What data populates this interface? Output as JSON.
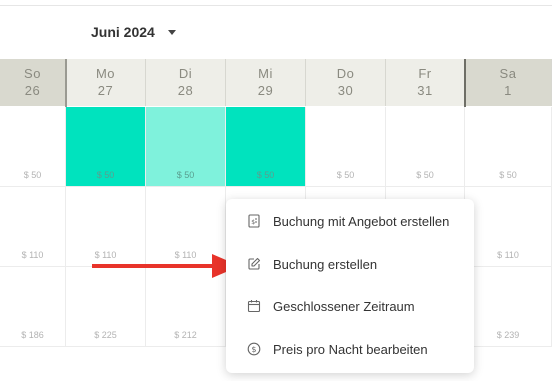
{
  "header": {
    "month": "Juni 2024",
    "month_dropdown_icon": "caret-down-icon"
  },
  "days": [
    {
      "name": "So",
      "date": "26",
      "type": "weekend"
    },
    {
      "name": "Mo",
      "date": "27",
      "type": "week"
    },
    {
      "name": "Di",
      "date": "28",
      "type": "week"
    },
    {
      "name": "Mi",
      "date": "29",
      "type": "week"
    },
    {
      "name": "Do",
      "date": "30",
      "type": "week"
    },
    {
      "name": "Fr",
      "date": "31",
      "type": "week"
    },
    {
      "name": "Sa",
      "date": "1",
      "type": "weekend"
    }
  ],
  "rows": [
    {
      "prices": [
        "$ 50",
        "$ 50",
        "$ 50",
        "$ 50",
        "$ 50",
        "$ 50",
        "$ 50"
      ],
      "states": [
        "free",
        "booked",
        "booked-light",
        "booked",
        "free",
        "free",
        "free"
      ]
    },
    {
      "prices": [
        "$ 110",
        "$ 110",
        "$ 110",
        "",
        "",
        "",
        "$ 110"
      ],
      "states": [
        "free",
        "free",
        "free",
        "free",
        "free",
        "free",
        "free"
      ]
    },
    {
      "prices": [
        "$ 186",
        "$ 225",
        "$ 212",
        "",
        "",
        "",
        "$ 239"
      ],
      "states": [
        "free",
        "free",
        "free",
        "free",
        "free",
        "free",
        "free"
      ]
    }
  ],
  "context_menu": {
    "items": [
      {
        "label": "Buchung mit Angebot erstellen",
        "icon": "quote-document-icon"
      },
      {
        "label": "Buchung erstellen",
        "icon": "edit-pencil-icon"
      },
      {
        "label": "Geschlossener Zeitraum",
        "icon": "calendar-icon"
      },
      {
        "label": "Preis pro Nacht bearbeiten",
        "icon": "dollar-coin-icon"
      }
    ]
  },
  "colors": {
    "booked": "#00e3be",
    "booked_light": "#7ff2dc",
    "arrow": "#e8332a"
  }
}
